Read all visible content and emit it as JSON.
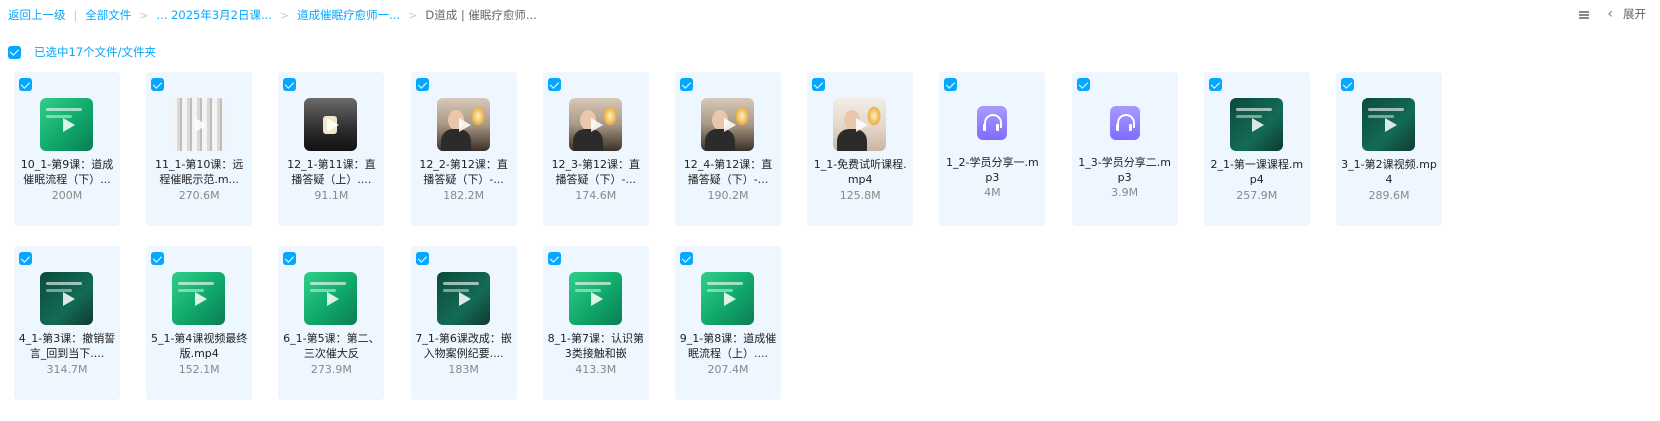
{
  "breadcrumb": {
    "items": [
      "返回上一级",
      "全部文件",
      "... 2025年3月2日课...",
      "道成催眠疗愈师一...",
      "D道成 | 催眠疗愈师..."
    ]
  },
  "toolbar": {
    "view_icon": "list-view-icon",
    "chevron_icon": "chevron-left-icon",
    "expand_label": "展开"
  },
  "selection": {
    "label": "已选中17个文件/文件夹",
    "checked": true
  },
  "files": [
    {
      "name": "10_1-第9课：道成催眠流程（下）...",
      "size": "200M",
      "type": "video",
      "thumb": "green"
    },
    {
      "name": "11_1-第10课：远程催眠示范.m...",
      "size": "270.6M",
      "type": "video",
      "thumb": "curtain"
    },
    {
      "name": "12_1-第11课：直播答疑（上）....",
      "size": "91.1M",
      "type": "video",
      "thumb": "dark"
    },
    {
      "name": "12_2-第12课：直播答疑（下）-...",
      "size": "182.2M",
      "type": "video",
      "thumb": "person"
    },
    {
      "name": "12_3-第12课：直播答疑（下）-...",
      "size": "174.6M",
      "type": "video",
      "thumb": "person"
    },
    {
      "name": "12_4-第12课：直播答疑（下）-...",
      "size": "190.2M",
      "type": "video",
      "thumb": "person"
    },
    {
      "name": "1_1-免费试听课程.mp4",
      "size": "125.8M",
      "type": "video",
      "thumb": "bright"
    },
    {
      "name": "1_2-学员分享一.mp3",
      "size": "4M",
      "type": "audio",
      "thumb": "audio"
    },
    {
      "name": "1_3-学员分享二.mp3",
      "size": "3.9M",
      "type": "audio",
      "thumb": "audio"
    },
    {
      "name": "2_1-第一课课程.mp4",
      "size": "257.9M",
      "type": "video",
      "thumb": "teal"
    },
    {
      "name": "3_1-第2课视频.mp4",
      "size": "289.6M",
      "type": "video",
      "thumb": "teal"
    },
    {
      "name": "4_1-第3课：撤销誓言_回到当下....",
      "size": "314.7M",
      "type": "video",
      "thumb": "teal"
    },
    {
      "name": "5_1-第4课视频最终版.mp4",
      "size": "152.1M",
      "type": "video",
      "thumb": "green"
    },
    {
      "name": "6_1-第5课：第二、三次催大反",
      "size": "273.9M",
      "type": "video",
      "thumb": "green"
    },
    {
      "name": "7_1-第6课改成：嵌入物案例纪要....",
      "size": "183M",
      "type": "video",
      "thumb": "teal"
    },
    {
      "name": "8_1-第7课：认识第3类接触和嵌",
      "size": "413.3M",
      "type": "video",
      "thumb": "green"
    },
    {
      "name": "9_1-第8课：道成催眠流程（上）....",
      "size": "207.4M",
      "type": "video",
      "thumb": "green"
    }
  ]
}
